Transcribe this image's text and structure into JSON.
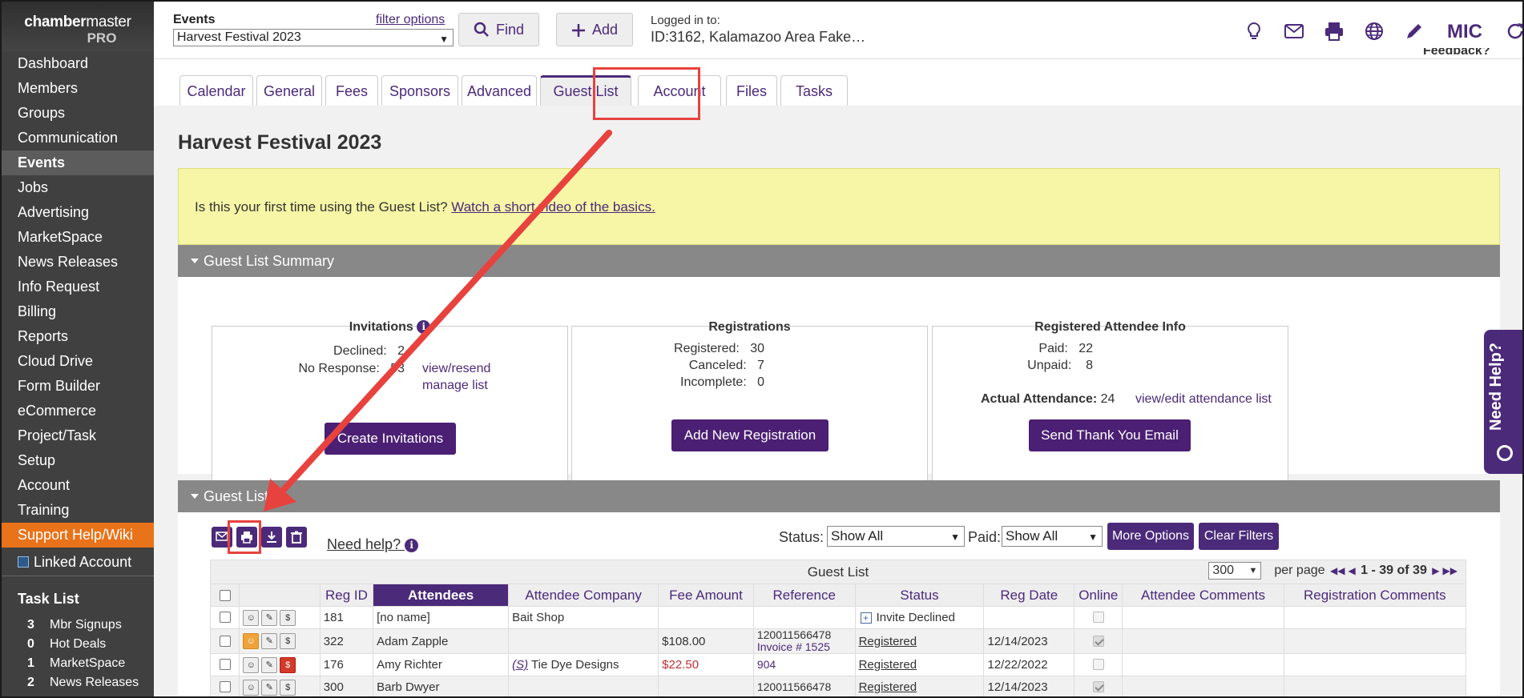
{
  "sidebar": {
    "logo_bold": "chamber",
    "logo_regular": "master",
    "logo_sub": "PRO",
    "nav": [
      "Dashboard",
      "Members",
      "Groups",
      "Communication",
      "Events",
      "Jobs",
      "Advertising",
      "MarketSpace",
      "News Releases",
      "Info Request",
      "Billing",
      "Reports",
      "Cloud Drive",
      "Form Builder",
      "eCommerce",
      "Project/Task",
      "Setup",
      "Account",
      "Training"
    ],
    "active_item": "Events",
    "support": "Support Help/Wiki",
    "linked_account": "Linked Account",
    "task_list_title": "Task List",
    "tasks": [
      {
        "count": "3",
        "label": "Mbr Signups"
      },
      {
        "count": "0",
        "label": "Hot Deals"
      },
      {
        "count": "1",
        "label": "MarketSpace"
      },
      {
        "count": "2",
        "label": "News Releases"
      }
    ]
  },
  "topbar": {
    "events_label": "Events",
    "filter_options": "filter options",
    "event_selected": "Harvest Festival 2023",
    "find_label": "Find",
    "add_label": "Add",
    "logged_in_label": "Logged in to:",
    "logged_in_value": "ID:3162, Kalamazoo Area Fake…",
    "user_initials": "MIC",
    "feedback": "Feedback?",
    "icons": [
      "lightbulb-icon",
      "mail-icon",
      "print-icon",
      "globe-icon",
      "pencil-icon",
      "refresh-icon"
    ]
  },
  "tabs": [
    "Calendar",
    "General",
    "Fees",
    "Sponsors",
    "Advanced",
    "Guest List",
    "Account",
    "Files",
    "Tasks"
  ],
  "active_tab": "Guest List",
  "page_title": "Harvest Festival 2023",
  "notice": {
    "text": "Is this your first time using the Guest List? ",
    "link": "Watch a short video of the basics."
  },
  "summary": {
    "header": "Guest List Summary",
    "invitations": {
      "title": "Invitations",
      "declined_label": "Declined:",
      "declined": "2",
      "no_response_label": "No Response:",
      "no_response": "53",
      "view_resend": "view/resend",
      "manage_list": "manage list",
      "button": "Create Invitations"
    },
    "registrations": {
      "title": "Registrations",
      "registered_label": "Registered:",
      "registered": "30",
      "canceled_label": "Canceled:",
      "canceled": "7",
      "incomplete_label": "Incomplete:",
      "incomplete": "0",
      "button": "Add New Registration"
    },
    "attendee_info": {
      "title": "Registered Attendee Info",
      "paid_label": "Paid:",
      "paid": "22",
      "unpaid_label": "Unpaid:",
      "unpaid": "8",
      "actual_label": "Actual Attendance:",
      "actual": "24",
      "view_edit": "view/edit attendance list",
      "button": "Send Thank You Email"
    }
  },
  "guest_list": {
    "header": "Guest List",
    "need_help": "Need help?",
    "status_label": "Status:",
    "status_value": "Show All",
    "paid_label": "Paid:",
    "paid_value": "Show All",
    "more_options": "More Options",
    "clear_filters": "Clear Filters",
    "table_caption": "Guest List",
    "per_page_value": "300",
    "per_page_label": "per page",
    "range": "1 - 39 of 39",
    "columns": [
      "Reg ID",
      "Attendees",
      "Attendee Company",
      "Fee Amount",
      "Reference",
      "Status",
      "Reg Date",
      "Online",
      "Attendee Comments",
      "Registration Comments"
    ],
    "sorted_column": "Attendees",
    "rows": [
      {
        "reg_id": "181",
        "attendee": "[no name]",
        "company": "Bait Shop",
        "company_prefix": "",
        "fee": "",
        "ref_line1": "",
        "ref_line2": "",
        "status": "Invite Declined",
        "status_icon": "+",
        "reg_date": "",
        "online": "disabled"
      },
      {
        "reg_id": "322",
        "attendee": "Adam Zapple",
        "company": "",
        "company_prefix": "",
        "fee": "$108.00",
        "ref_line1": "120011566478",
        "ref_line2": "Invoice # 1525",
        "status": "Registered",
        "status_icon": "",
        "reg_date": "12/14/2023",
        "online": "checked"
      },
      {
        "reg_id": "176",
        "attendee": "Amy Richter",
        "company": "Tie Dye Designs",
        "company_prefix": "(S)",
        "fee": "$22.50",
        "ref_line1": "904",
        "ref_line2": "",
        "status": "Registered",
        "status_icon": "",
        "reg_date": "12/22/2022",
        "online": "unchecked"
      },
      {
        "reg_id": "300",
        "attendee": "Barb Dwyer",
        "company": "",
        "company_prefix": "",
        "fee": "",
        "ref_line1": "120011566478",
        "ref_line2": "",
        "status": "Registered",
        "status_icon": "",
        "reg_date": "12/14/2023",
        "online": "checked"
      }
    ]
  },
  "help_tab": "Need Help?"
}
